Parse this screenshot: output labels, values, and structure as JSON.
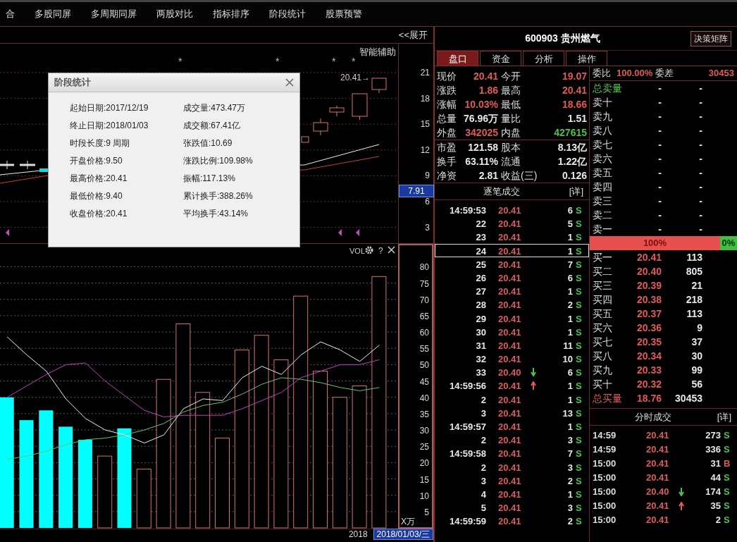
{
  "menu": [
    {
      "label": "合"
    },
    {
      "label": "多股同屏"
    },
    {
      "label": "多周期同屏"
    },
    {
      "label": "两股对比"
    },
    {
      "label": "指标排序"
    },
    {
      "label": "阶段统计"
    },
    {
      "label": "股票预警"
    }
  ],
  "expand_button": "<<展开",
  "price_chart": {
    "assist_label": "智能辅助",
    "star_marks": [
      "*",
      "*",
      "*",
      "*"
    ],
    "high_note": "20.41→",
    "axis": [
      "21",
      "18",
      "15",
      "12",
      "9",
      "6",
      "3"
    ],
    "last_price": "7.91"
  },
  "stage_dialog": {
    "title": "阶段统计",
    "rows": [
      {
        "left": "起始日期:2017/12/19",
        "right": "成交量:473.47万"
      },
      {
        "left": "终止日期:2018/01/03",
        "right": "成交额:67.41亿"
      },
      {
        "left": "时段长度:9 周期",
        "right": "张跌值:10.69"
      },
      {
        "left": "开盘价格:9.50",
        "right": "涨跌比例:109.98%"
      },
      {
        "left": "最高价格:20.41",
        "right": "振幅:117.13%"
      },
      {
        "left": "最低价格:9.40",
        "right": "累计换手:388.26%"
      },
      {
        "left": "收盘价格:20.41",
        "right": "平均换手:43.14%"
      }
    ]
  },
  "volume_chart": {
    "title": "VOL",
    "help": "?",
    "unit": "X万",
    "chart_data": {
      "type": "bar",
      "grid": true,
      "ylim": [
        0,
        87
      ],
      "yticks": [
        5,
        10,
        15,
        20,
        25,
        30,
        35,
        40,
        45,
        50,
        55,
        60,
        65,
        70,
        75,
        80
      ],
      "series": [
        {
          "type": "line",
          "color": "#eeeeee",
          "values": [
            58.5,
            53,
            48,
            39.5,
            33.5,
            30,
            28.5,
            26,
            28.5,
            36.5,
            39.5,
            39,
            46,
            49.5,
            47,
            53,
            57,
            54.5,
            51,
            56
          ]
        },
        {
          "type": "line",
          "color": "#c040c0",
          "values": [
            40,
            43.5,
            47,
            50,
            50.5,
            45,
            40.5,
            36,
            34,
            34.5,
            34.5,
            34.5,
            36.5,
            39,
            41.5,
            46,
            48,
            50,
            50,
            51.5
          ]
        },
        {
          "type": "line",
          "color": "#70c070",
          "values": [
            21,
            22,
            23.5,
            25.5,
            27,
            27.5,
            28.5,
            30,
            32,
            35.5,
            37.5,
            38.5,
            41,
            44,
            46,
            45.5,
            44.5,
            43,
            42,
            43
          ]
        },
        {
          "color": "#00ffff",
          "values": [
            40,
            33,
            36,
            31,
            27,
            null,
            30.5,
            null,
            null,
            null,
            null,
            null,
            null,
            null,
            null,
            null,
            null,
            null,
            null,
            null
          ]
        },
        {
          "color": "#d87070",
          "values": [
            null,
            null,
            null,
            null,
            null,
            22,
            null,
            18,
            45.5,
            62.5,
            41.5,
            27.5,
            54.5,
            59,
            51.5,
            71,
            48,
            40,
            43.5,
            77
          ]
        }
      ]
    }
  },
  "date_bar": {
    "year": "2018",
    "cursor_date": "2018/01/03/三"
  },
  "quote": {
    "title": "600903 贵州燃气",
    "matrix_button": "决策矩阵",
    "tabs": [
      {
        "label": "盘口",
        "selected": true
      },
      {
        "label": "资金",
        "selected": false
      },
      {
        "label": "分析",
        "selected": false
      },
      {
        "label": "操作",
        "selected": false
      }
    ],
    "stats_top": [
      [
        {
          "label": "现价",
          "value": "20.41",
          "color": "#e05a5a"
        },
        {
          "label": "今开",
          "value": "19.07",
          "color": "#e05a5a"
        }
      ],
      [
        {
          "label": "涨跌",
          "value": "1.86",
          "color": "#e05a5a"
        },
        {
          "label": "最高",
          "value": "20.41",
          "color": "#e05a5a"
        }
      ],
      [
        {
          "label": "涨幅",
          "value": "10.03%",
          "color": "#e05a5a"
        },
        {
          "label": "最低",
          "value": "18.66",
          "color": "#e05a5a"
        }
      ],
      [
        {
          "label": "总量",
          "value": "76.96万",
          "color": "#e8e8e8"
        },
        {
          "label": "量比",
          "value": "1.51",
          "color": "#e8e8e8"
        }
      ],
      [
        {
          "label": "外盘",
          "value": "342025",
          "color": "#e05a5a"
        },
        {
          "label": "内盘",
          "value": "427615",
          "color": "#50c050"
        }
      ]
    ],
    "stats_bottom": [
      [
        {
          "label": "市盈",
          "value": "121.58",
          "color": "#e8e8e8"
        },
        {
          "label": "股本",
          "value": "8.13亿",
          "color": "#e8e8e8"
        }
      ],
      [
        {
          "label": "换手",
          "value": "63.11%",
          "color": "#e8e8e8"
        },
        {
          "label": "流通",
          "value": "1.22亿",
          "color": "#e8e8e8"
        }
      ],
      [
        {
          "label": "净资",
          "value": "2.81",
          "color": "#e8e8e8"
        },
        {
          "label": "收益(三)",
          "value": "0.126",
          "color": "#e8e8e8"
        }
      ]
    ]
  },
  "order_book": {
    "ratio_label": "委比",
    "ratio": "100.00%",
    "diff_label": "委差",
    "diff": "30453",
    "sell_total": {
      "label": "总卖量",
      "price": "-",
      "volume": "-"
    },
    "asks": [
      {
        "label": "卖十",
        "price": "-",
        "volume": "-"
      },
      {
        "label": "卖九",
        "price": "-",
        "volume": "-"
      },
      {
        "label": "卖八",
        "price": "-",
        "volume": "-"
      },
      {
        "label": "卖七",
        "price": "-",
        "volume": "-"
      },
      {
        "label": "卖六",
        "price": "-",
        "volume": "-"
      },
      {
        "label": "卖五",
        "price": "-",
        "volume": "-"
      },
      {
        "label": "卖四",
        "price": "-",
        "volume": "-"
      },
      {
        "label": "卖三",
        "price": "-",
        "volume": "-"
      },
      {
        "label": "卖二",
        "price": "-",
        "volume": "-"
      },
      {
        "label": "卖一",
        "price": "-",
        "volume": "-"
      }
    ],
    "bar": {
      "buy_text": "100%",
      "sell_text": "0%",
      "level": 1.0
    },
    "bids": [
      {
        "label": "买一",
        "price": "20.41",
        "volume": "113"
      },
      {
        "label": "买二",
        "price": "20.40",
        "volume": "805"
      },
      {
        "label": "买三",
        "price": "20.39",
        "volume": "21"
      },
      {
        "label": "买四",
        "price": "20.38",
        "volume": "218"
      },
      {
        "label": "买五",
        "price": "20.37",
        "volume": "113"
      },
      {
        "label": "买六",
        "price": "20.36",
        "volume": "9"
      },
      {
        "label": "买七",
        "price": "20.35",
        "volume": "37"
      },
      {
        "label": "买八",
        "price": "20.34",
        "volume": "30"
      },
      {
        "label": "买九",
        "price": "20.33",
        "volume": "99"
      },
      {
        "label": "买十",
        "price": "20.32",
        "volume": "56"
      }
    ],
    "buy_total": {
      "label": "总买量",
      "price": "18.76",
      "volume": "30453"
    }
  },
  "ticks": {
    "title": "逐笔成交",
    "detail": "[详]",
    "rows": [
      {
        "kind": "plain",
        "time": "14:59:53",
        "price": "20.41",
        "volume": "6",
        "side": "S",
        "color": "#50c050",
        "selected": false
      },
      {
        "kind": "plain",
        "time": "22",
        "price": "20.41",
        "volume": "5",
        "side": "S",
        "color": "#50c050",
        "selected": false
      },
      {
        "kind": "plain",
        "time": "23",
        "price": "20.41",
        "volume": "1",
        "side": "S",
        "color": "#50c050",
        "selected": false
      },
      {
        "kind": "plain",
        "time": "24",
        "price": "20.41",
        "volume": "1",
        "side": "S",
        "color": "#50c050",
        "selected": true
      },
      {
        "kind": "plain",
        "time": "25",
        "price": "20.41",
        "volume": "7",
        "side": "S",
        "color": "#50c050",
        "selected": false
      },
      {
        "kind": "plain",
        "time": "26",
        "price": "20.41",
        "volume": "6",
        "side": "S",
        "color": "#50c050",
        "selected": false
      },
      {
        "kind": "plain",
        "time": "27",
        "price": "20.41",
        "volume": "1",
        "side": "S",
        "color": "#50c050",
        "selected": false
      },
      {
        "kind": "plain",
        "time": "28",
        "price": "20.41",
        "volume": "2",
        "side": "S",
        "color": "#50c050",
        "selected": false
      },
      {
        "kind": "plain",
        "time": "29",
        "price": "20.41",
        "volume": "1",
        "side": "S",
        "color": "#50c050",
        "selected": false
      },
      {
        "kind": "plain",
        "time": "30",
        "price": "20.41",
        "volume": "1",
        "side": "S",
        "color": "#50c050",
        "selected": false
      },
      {
        "kind": "plain",
        "time": "31",
        "price": "20.41",
        "volume": "11",
        "side": "S",
        "color": "#50c050",
        "selected": false
      },
      {
        "kind": "plain",
        "time": "32",
        "price": "20.41",
        "volume": "10",
        "side": "S",
        "color": "#50c050",
        "selected": false
      },
      {
        "kind": "down",
        "time": "33",
        "price": "20.40",
        "volume": "6",
        "side": "S",
        "color": "#50c050",
        "selected": false
      },
      {
        "kind": "up",
        "time": "14:59:56",
        "price": "20.41",
        "volume": "1",
        "side": "S",
        "color": "#50c050",
        "selected": false
      },
      {
        "kind": "plain",
        "time": "2",
        "price": "20.41",
        "volume": "1",
        "side": "S",
        "color": "#50c050",
        "selected": false
      },
      {
        "kind": "plain",
        "time": "3",
        "price": "20.41",
        "volume": "13",
        "side": "S",
        "color": "#50c050",
        "selected": false
      },
      {
        "kind": "plain",
        "time": "14:59:57",
        "price": "20.41",
        "volume": "1",
        "side": "S",
        "color": "#50c050",
        "selected": false
      },
      {
        "kind": "plain",
        "time": "2",
        "price": "20.41",
        "volume": "3",
        "side": "S",
        "color": "#50c050",
        "selected": false
      },
      {
        "kind": "plain",
        "time": "14:59:58",
        "price": "20.41",
        "volume": "7",
        "side": "S",
        "color": "#50c050",
        "selected": false
      },
      {
        "kind": "plain",
        "time": "2",
        "price": "20.41",
        "volume": "3",
        "side": "S",
        "color": "#50c050",
        "selected": false
      },
      {
        "kind": "plain",
        "time": "3",
        "price": "20.41",
        "volume": "2",
        "side": "S",
        "color": "#50c050",
        "selected": false
      },
      {
        "kind": "plain",
        "time": "4",
        "price": "20.41",
        "volume": "1",
        "side": "S",
        "color": "#50c050",
        "selected": false
      },
      {
        "kind": "plain",
        "time": "5",
        "price": "20.41",
        "volume": "3",
        "side": "S",
        "color": "#50c050",
        "selected": false
      },
      {
        "kind": "plain",
        "time": "14:59:59",
        "price": "20.41",
        "volume": "2",
        "side": "S",
        "color": "#50c050",
        "selected": false
      }
    ]
  },
  "minute_trades": {
    "title": "分时成交",
    "detail": "[详]",
    "rows": [
      {
        "kind": "plain",
        "time": "14:59",
        "price": "20.41",
        "volume": "273",
        "side": "S",
        "color": "#50c050"
      },
      {
        "kind": "plain",
        "time": "14:59",
        "price": "20.41",
        "volume": "336",
        "side": "S",
        "color": "#50c050"
      },
      {
        "kind": "plain",
        "time": "15:00",
        "price": "20.41",
        "volume": "31",
        "side": "B",
        "color": "#e05a5a"
      },
      {
        "kind": "plain",
        "time": "15:00",
        "price": "20.41",
        "volume": "44",
        "side": "S",
        "color": "#50c050"
      },
      {
        "kind": "down",
        "time": "15:00",
        "price": "20.40",
        "volume": "174",
        "side": "S",
        "color": "#50c050"
      },
      {
        "kind": "up",
        "time": "15:00",
        "price": "20.41",
        "volume": "35",
        "side": "S",
        "color": "#50c050"
      },
      {
        "kind": "plain",
        "time": "15:00",
        "price": "20.41",
        "volume": "2",
        "side": "S",
        "color": "#50c050"
      }
    ]
  }
}
